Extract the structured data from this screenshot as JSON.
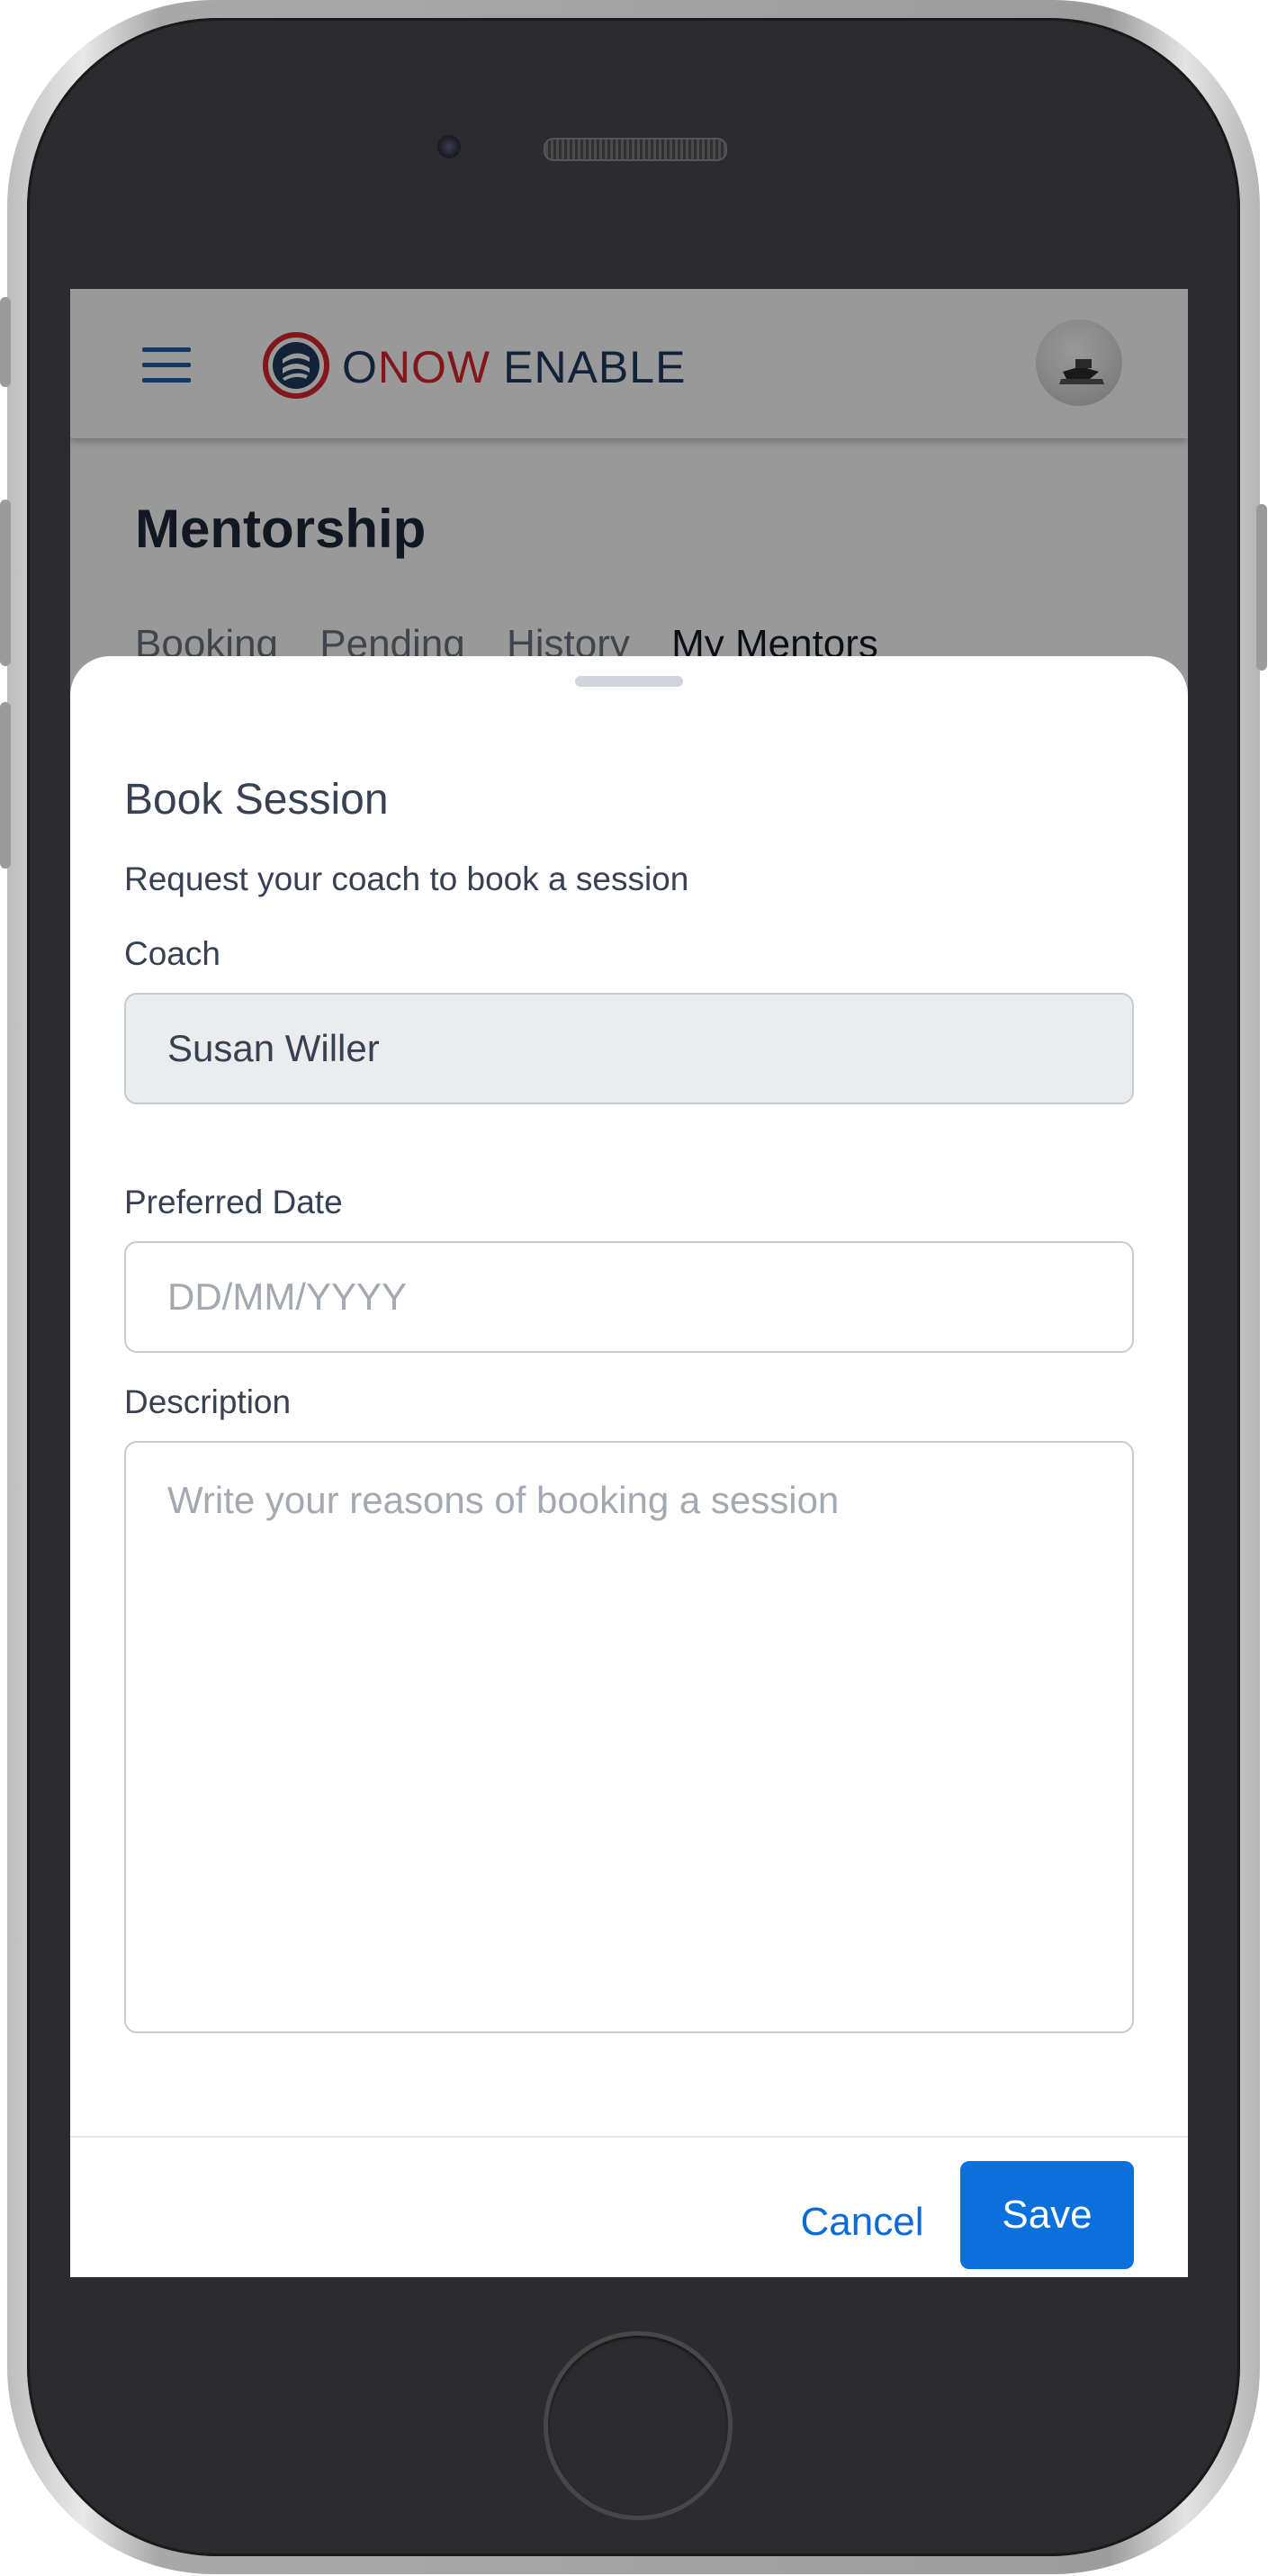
{
  "header": {
    "brand_o": "O",
    "brand_now": "NOW",
    "brand_enable": "ENABLE"
  },
  "page": {
    "title": "Mentorship",
    "tabs": [
      {
        "label": "Booking"
      },
      {
        "label": "Pending"
      },
      {
        "label": "History"
      },
      {
        "label": "My Mentors",
        "active": true
      }
    ]
  },
  "sheet": {
    "title": "Book Session",
    "subtitle": "Request your coach to book a session",
    "coach_label": "Coach",
    "coach_value": "Susan Willer",
    "date_label": "Preferred Date",
    "date_placeholder": "DD/MM/YYYY",
    "description_label": "Description",
    "description_placeholder": "Write your reasons of booking a session",
    "cancel_label": "Cancel",
    "save_label": "Save"
  },
  "colors": {
    "primary": "#0b6fdc",
    "brand_red": "#d7262e",
    "brand_navy": "#1d3a5f"
  }
}
